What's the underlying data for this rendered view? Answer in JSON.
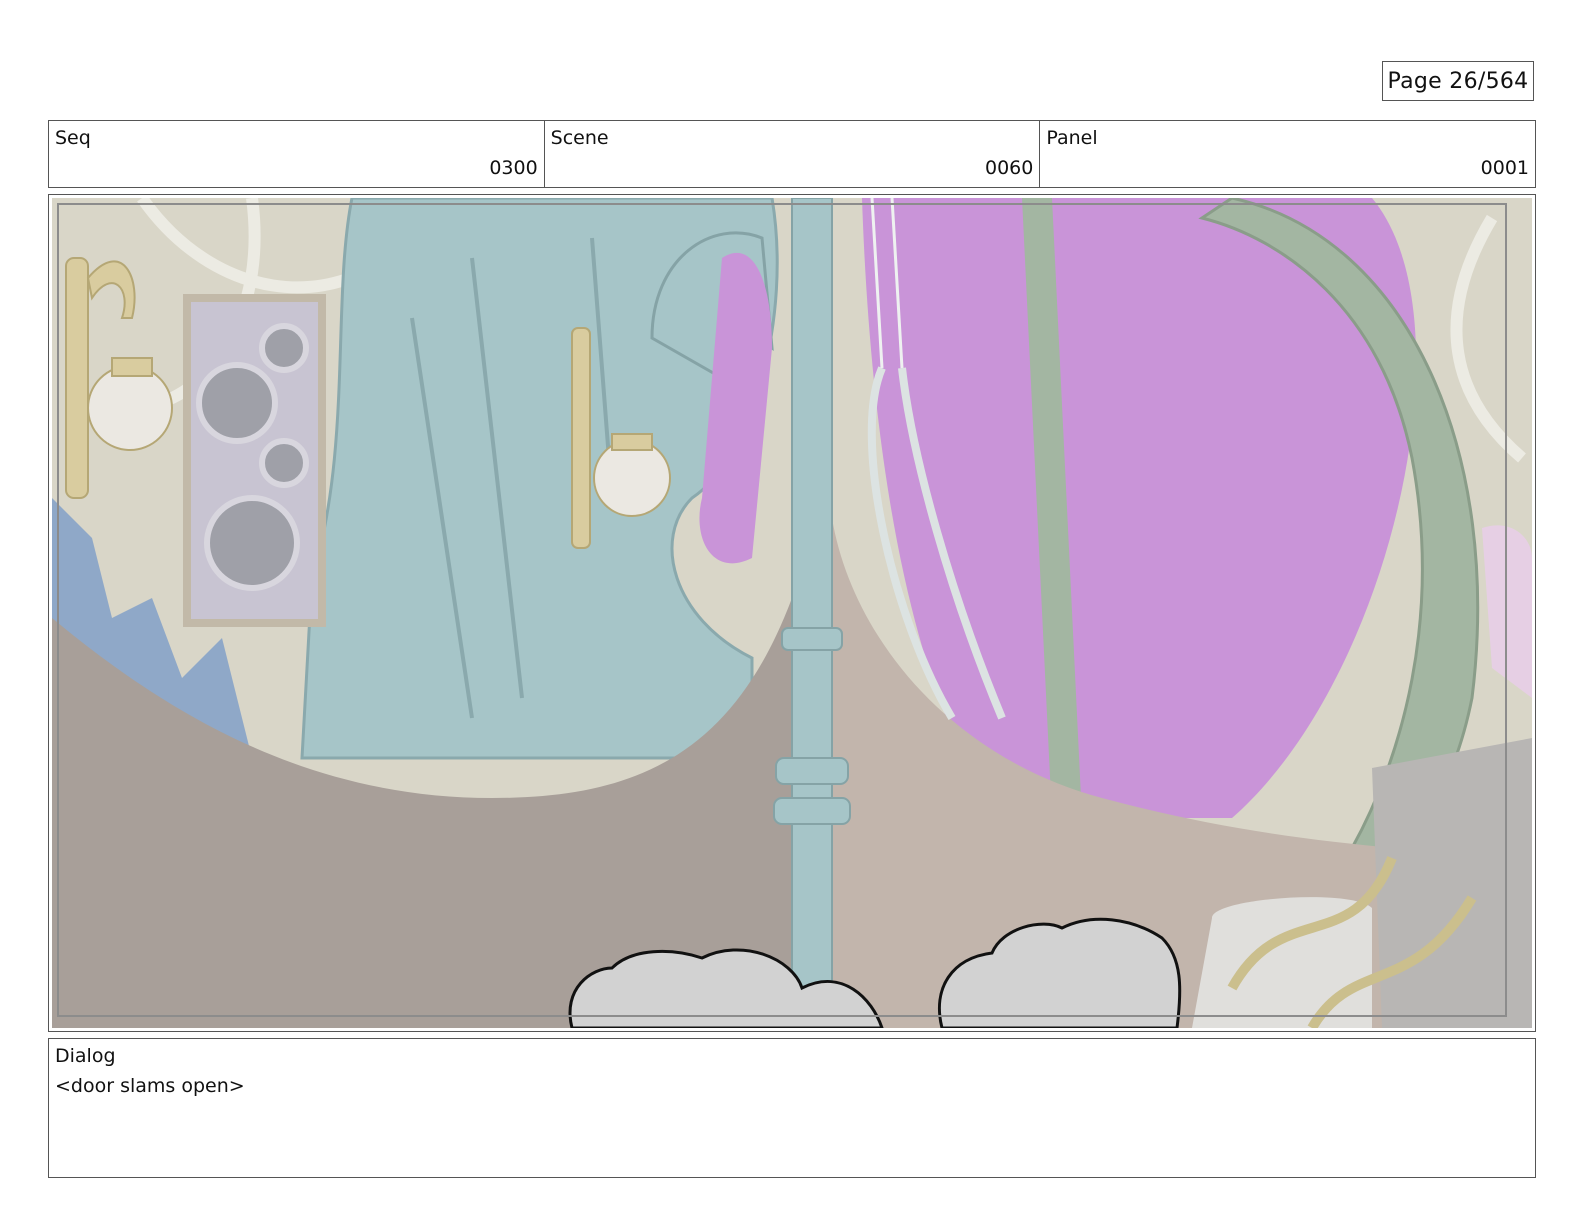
{
  "page": {
    "label": "Page",
    "number": "26/564"
  },
  "header": {
    "seq": {
      "label": "Seq",
      "value": "0300"
    },
    "scene": {
      "label": "Scene",
      "value": "0060"
    },
    "panel": {
      "label": "Panel",
      "value": "0001"
    }
  },
  "dialog": {
    "label": "Dialog",
    "text": "<door slams open>"
  },
  "colors": {
    "border": "#555555",
    "wall_cream": "#d9d6c8",
    "teal": "#a6c5c8",
    "magenta": "#c994d8",
    "floor_brown": "#a89f99",
    "floor_tan": "#c2b5ac",
    "arch_green": "#a3b6a2",
    "blue_drape": "#8fa8c8"
  }
}
